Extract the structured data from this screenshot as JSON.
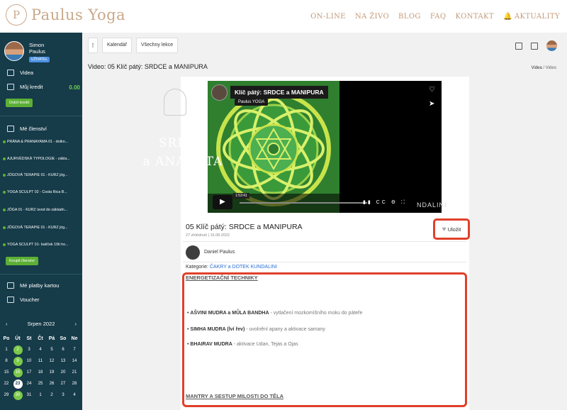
{
  "header": {
    "logo_text": "Paulus Yoga",
    "nav": [
      "ON-LINE",
      "NA ŽIVO",
      "BLOG",
      "FAQ",
      "KONTAKT",
      "AKTUALITY"
    ]
  },
  "sidebar": {
    "user_first": "Simon",
    "user_last": "Paulus",
    "role_badge": "UŽIVATEL",
    "video_label": "Videa",
    "credit_label": "Můj kredit",
    "credit_value": "0.00",
    "topup_button": "Dobít kredit",
    "memberships_label": "Mé členství",
    "courses": [
      "PRÁNA & PRANAYAMA 01 - dotkn...",
      "AJURVÉDSKÁ TYPOLOGIE - zákla...",
      "JÓGOVÁ TERAPIE 01 - KURZ jóg...",
      "YOGA SCULPT 02 - Costa Rica B...",
      "JÓGA 01 - KURZ úvod do základn...",
      "JÓGOVÁ TERAPIE 01 - KURZ jóg...",
      "YOGA SCULPT 01- balíček 10ti ho..."
    ],
    "buy_membership_button": "Koupit členství",
    "cards_label": "Mé platby kartou",
    "voucher_label": "Voucher",
    "calendar": {
      "month": "Srpen 2022",
      "prev": "‹",
      "next": "›",
      "dow": [
        "Po",
        "Út",
        "St",
        "Čt",
        "Pá",
        "So",
        "Ne"
      ],
      "days": [
        "1",
        "2",
        "3",
        "4",
        "5",
        "6",
        "7",
        "8",
        "9",
        "10",
        "11",
        "12",
        "13",
        "14",
        "15",
        "16",
        "17",
        "18",
        "19",
        "20",
        "21",
        "22",
        "23",
        "24",
        "25",
        "26",
        "27",
        "28",
        "29",
        "30",
        "31",
        "1",
        "2",
        "3",
        "4"
      ],
      "highlighted": [
        "2",
        "9",
        "16",
        "30"
      ],
      "today": "23"
    }
  },
  "toolbar": {
    "more_label": "⋮",
    "calendar_button": "Kalendář",
    "all_lessons_button": "Všechny lekce"
  },
  "page": {
    "title": "Video: 05 Klíč pátý: SRDCE a MANIPURA",
    "breadcrumb_1": "Videa",
    "breadcrumb_sep": "/",
    "breadcrumb_2": "Video"
  },
  "video": {
    "overlay_title": "Klíč pátý: SRDCE a MANIPURA",
    "channel": "Paulus YOGA",
    "right_word_1": "SRDCE",
    "right_word_2": "a ANAHATA",
    "time": "1:53:41",
    "brand": "NDALINI",
    "controls_icons": "▮▮ CC ⚙ ⛶"
  },
  "detail": {
    "title": "05 Klíč pátý: SRDCE a MANIPURA",
    "meta": "27 zhlédnutí | 16.08.2022",
    "save_label": "Uložit",
    "author": "Daniel Paulus",
    "category_label": "Kategorie:",
    "category_link": "ČAKRY a DOTEK KUNDALINI",
    "section_1": "ENERGETIZAČNÍ TECHNIKY",
    "bullets": [
      {
        "bold": "AŠVINI MUDRA a MŮLA BANDHA",
        "rest": " - vytlačení mozkomíšního moku do páteře"
      },
      {
        "bold": "SIMHA MUDRA (lví řev)",
        "rest": " - uvolnění apany a aktivace samany"
      },
      {
        "bold": "BHAIRAV MUDRA",
        "rest": " - aktivace Udan, Tejas a Ojas"
      }
    ],
    "section_2": "MANTRY A SESTUP MILOSTI DO TĚLA"
  }
}
